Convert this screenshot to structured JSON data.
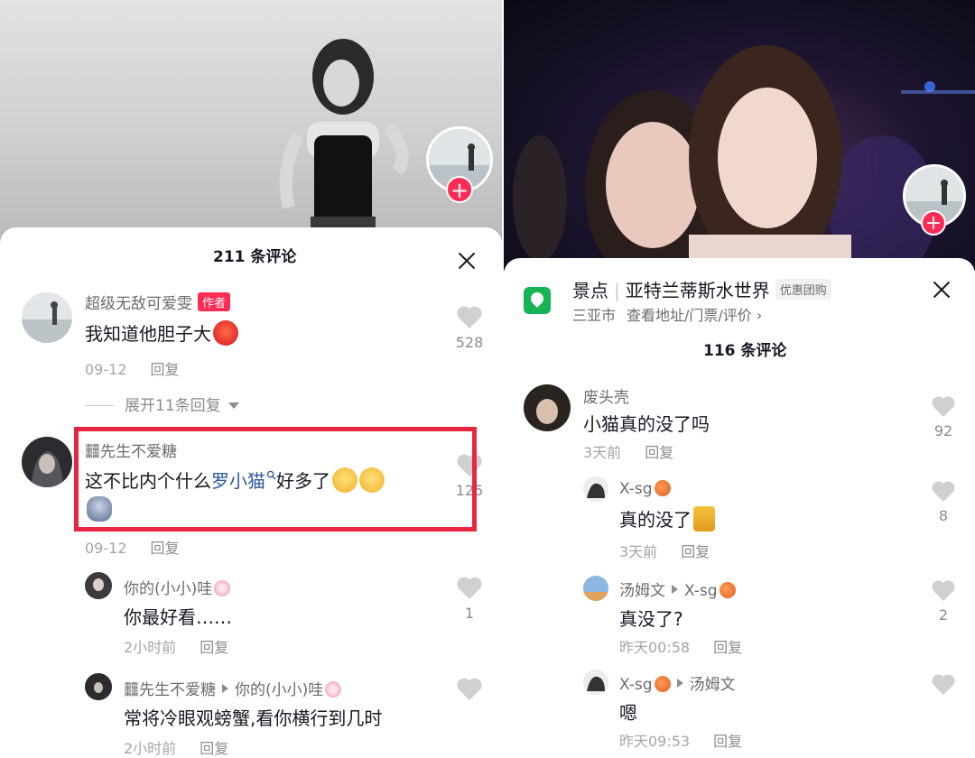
{
  "left": {
    "comment_count_title": "211 条评论",
    "comments": [
      {
        "name": "超级无敌可爱雯",
        "badge": "作者",
        "text": "我知道他胆子大",
        "date": "09-12",
        "reply": "回复",
        "likes": "528"
      },
      {
        "name": "䨻先生不爱糖",
        "text_pre": "这不比内个什么",
        "text_link": "罗小猫",
        "text_post": "好多了",
        "date": "09-12",
        "reply": "回复",
        "likes": "125"
      }
    ],
    "expand": "展开11条回复",
    "replies": [
      {
        "name": "你的(小小)哇",
        "text": "你最好看……",
        "time": "2小时前",
        "reply": "回复",
        "likes": "1"
      },
      {
        "name": "䨻先生不爱糖",
        "to": "你的(小小)哇",
        "text": "常将冷眼观螃蟹,看你横行到几时",
        "time": "2小时前",
        "reply": "回复"
      }
    ]
  },
  "right": {
    "location": {
      "category": "景点",
      "name": "亚特兰蒂斯水世界",
      "deal": "优惠团购",
      "city": "三亚市",
      "link": "查看地址/门票/评价 ›"
    },
    "comment_count_title": "116 条评论",
    "comments": [
      {
        "name": "废头壳",
        "text": "小猫真的没了吗",
        "time": "3天前",
        "reply": "回复",
        "likes": "92"
      }
    ],
    "replies": [
      {
        "name": "X-sg",
        "text": "真的没了",
        "time": "3天前",
        "reply": "回复",
        "likes": "8"
      },
      {
        "name": "汤姆文",
        "to": "X-sg",
        "text": "真没了?",
        "time": "昨天00:58",
        "reply": "回复",
        "likes": "2"
      },
      {
        "name": "X-sg",
        "to": "汤姆文",
        "text": "嗯",
        "time": "昨天09:53",
        "reply": "回复"
      }
    ]
  },
  "colors": {
    "accent_red": "#fe2c55",
    "highlight_red": "#e8263f",
    "link_blue": "#2d5a9e",
    "location_green": "#16b455"
  }
}
